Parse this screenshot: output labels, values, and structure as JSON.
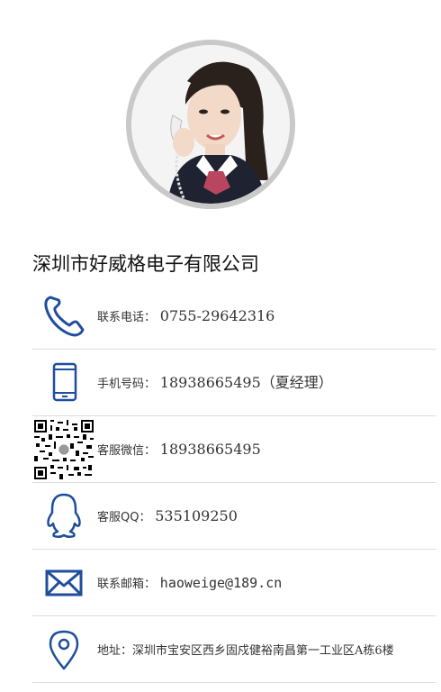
{
  "company": {
    "name": "深圳市好威格电子有限公司"
  },
  "colors": {
    "icon": "#1f4e9c",
    "divider": "#dcdcdc"
  },
  "contacts": [
    {
      "icon": "phone-icon",
      "label": "联系电话：",
      "value": "0755-29642316"
    },
    {
      "icon": "mobile-icon",
      "label": "手机号码：",
      "value": "18938665495（夏经理）"
    },
    {
      "icon": "qr-code-icon",
      "label": "客服微信：",
      "value": "18938665495"
    },
    {
      "icon": "qq-icon",
      "label": "客服QQ：",
      "value": "535109250"
    },
    {
      "icon": "mail-icon",
      "label": "联系邮箱：",
      "value": "haoweige@189.cn"
    },
    {
      "icon": "location-icon",
      "label": "地址：",
      "value": "深圳市宝安区西乡固戍健裕南昌第一工业区A栋6楼"
    }
  ]
}
